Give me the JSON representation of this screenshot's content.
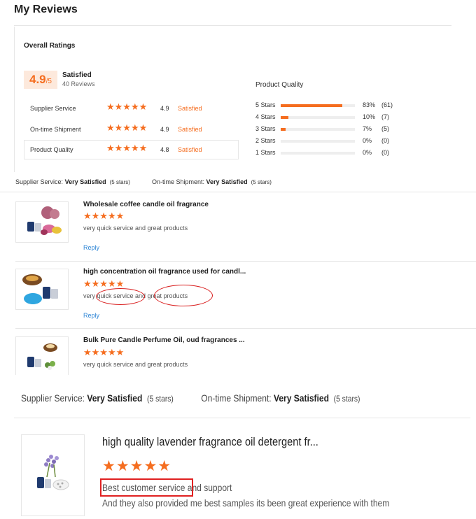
{
  "page": {
    "title": "My Reviews"
  },
  "overall": {
    "heading": "Overall Ratings",
    "score": "4.9",
    "score_suffix": "/5",
    "label": "Satisfied",
    "review_count": "40 Reviews",
    "ratings": [
      {
        "label": "Supplier Service",
        "stars": "★★★★★",
        "score": "4.9",
        "status": "Satisfied"
      },
      {
        "label": "On-time Shipment",
        "stars": "★★★★★",
        "score": "4.9",
        "status": "Satisfied"
      },
      {
        "label": "Product Quality",
        "stars": "★★★★★",
        "score": "4.8",
        "status": "Satisfied"
      }
    ]
  },
  "product_quality": {
    "title": "Product Quality",
    "distribution": [
      {
        "label": "5 Stars",
        "percent": "83%",
        "count": "(61)",
        "fraction": 0.83
      },
      {
        "label": "4 Stars",
        "percent": "10%",
        "count": "(7)",
        "fraction": 0.1
      },
      {
        "label": "3 Stars",
        "percent": "7%",
        "count": "(5)",
        "fraction": 0.07
      },
      {
        "label": "2 Stars",
        "percent": "0%",
        "count": "(0)",
        "fraction": 0
      },
      {
        "label": "1 Stars",
        "percent": "0%",
        "count": "(0)",
        "fraction": 0
      }
    ]
  },
  "panel2": {
    "summary": {
      "supplier_label": "Supplier Service:",
      "supplier_value": "Very Satisfied",
      "supplier_stars": "(5 stars)",
      "shipment_label": "On-time Shipment:",
      "shipment_value": "Very Satisfied",
      "shipment_stars": "(5 stars)"
    },
    "reviews": [
      {
        "title": "Wholesale coffee candle oil fragrance",
        "stars": "★★★★★",
        "text": "very quick service and great products",
        "reply": "Reply"
      },
      {
        "title": "high concentration oil fragrance used for candl...",
        "stars": "★★★★★",
        "text": "very quick service and great products",
        "reply": "Reply"
      },
      {
        "title": "Bulk Pure Candle Perfume Oil, oud fragrances ...",
        "stars": "★★★★★",
        "text": "very quick service and great products"
      }
    ]
  },
  "panel3": {
    "summary": {
      "supplier_label": "Supplier Service:",
      "supplier_value": "Very Satisfied",
      "supplier_stars": "(5 stars)",
      "shipment_label": "On-time Shipment:",
      "shipment_value": "Very Satisfied",
      "shipment_stars": "(5 stars)"
    },
    "review": {
      "title": "high quality lavender fragrance oil detergent fr...",
      "stars": "★★★★★",
      "highlight": "Best customer service",
      "line1_rest": "and support",
      "line2": "And they also provided me best samples  its been great experience with them"
    }
  },
  "colors": {
    "accent": "#f56d1f",
    "link": "#2f86d6",
    "annotation": "#e02020"
  }
}
